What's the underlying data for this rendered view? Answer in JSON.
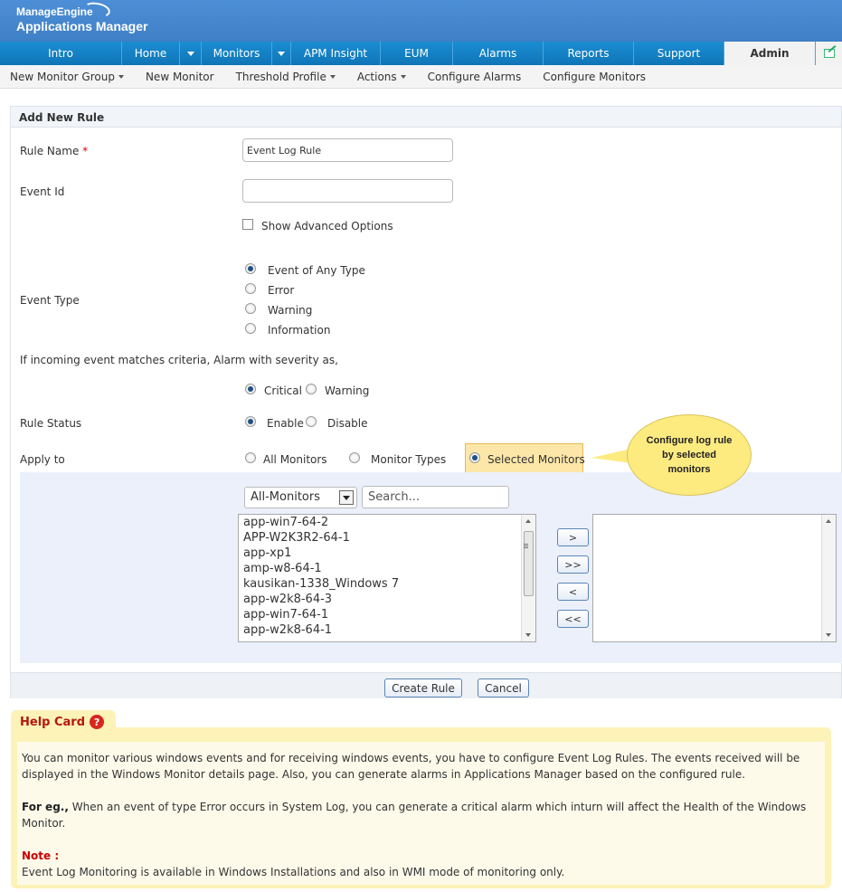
{
  "header": {
    "brand_top": "ManageEngine",
    "brand_bottom": "Applications Manager"
  },
  "mainnav": {
    "tabs": [
      "Intro",
      "Home",
      "Monitors",
      "APM Insight",
      "EUM",
      "Alarms",
      "Reports",
      "Support",
      "Admin"
    ],
    "active": "Admin"
  },
  "subnav": {
    "items": [
      "New Monitor Group",
      "New Monitor",
      "Threshold Profile",
      "Actions",
      "Configure Alarms",
      "Configure Monitors"
    ]
  },
  "form": {
    "title": "Add New Rule",
    "rule_name_label": "Rule Name",
    "required_mark": "*",
    "rule_name_value": "Event Log Rule",
    "event_id_label": "Event Id",
    "event_id_value": "",
    "show_advanced_label": "Show Advanced Options",
    "event_type_label": "Event Type",
    "event_types": [
      "Event of Any Type",
      "Error",
      "Warning",
      "Information"
    ],
    "event_type_selected": "Event of Any Type",
    "severity_text": "If incoming event matches criteria, Alarm with severity as,",
    "severity_options": [
      "Critical",
      "Warning"
    ],
    "severity_selected": "Critical",
    "rule_status_label": "Rule Status",
    "status_options": [
      "Enable",
      "Disable"
    ],
    "status_selected": "Enable",
    "apply_to_label": "Apply to",
    "apply_options": [
      "All Monitors",
      "Monitor Types",
      "Selected Monitors"
    ],
    "apply_selected": "Selected Monitors",
    "callout": "Configure log rule by selected monitors",
    "monitor_filter": "All-Monitors",
    "search_placeholder": "Search...",
    "available_monitors": [
      "app-win7-64-2",
      "APP-W2K3R2-64-1",
      "app-xp1",
      "amp-w8-64-1",
      "kausikan-1338_Windows 7",
      "app-w2k8-64-3",
      "app-win7-64-1",
      "app-w2k8-64-1"
    ],
    "move_buttons": [
      ">",
      ">>",
      "<",
      "<<"
    ],
    "create_button": "Create Rule",
    "cancel_button": "Cancel"
  },
  "help": {
    "title": "Help Card",
    "q": "?",
    "p1": "You can monitor various windows events and for receiving windows events, you have to configure Event Log Rules. The events received will be displayed in the Windows Monitor details page. Also, you can generate alarms in Applications Manager based on the configured rule.",
    "p2_bold": "For eg.,",
    "p2": " When an event of type Error occurs in System Log, you can generate a critical alarm which inturn will affect the Health of the Windows Monitor.",
    "note_label": "Note :",
    "note": "Event Log Monitoring is available in Windows Installations and also in WMI mode of monitoring only."
  },
  "colors": {
    "header_blue": "#4d8fd6",
    "nav_blue": "#1b8dd2",
    "highlight": "#fde7a8",
    "callout": "#fdeb80",
    "help_bg": "#fdf2b8",
    "help_title": "#b3180c"
  }
}
